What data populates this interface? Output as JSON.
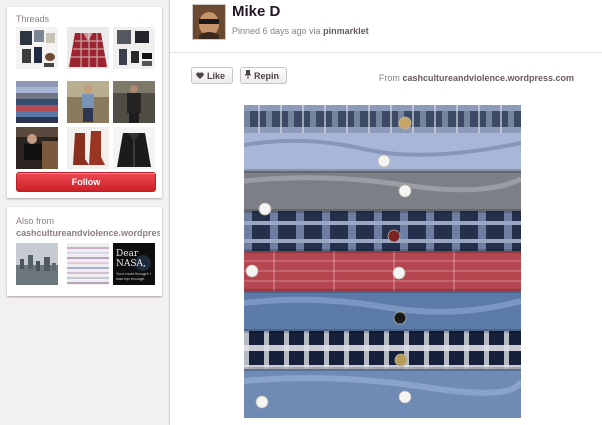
{
  "board": {
    "title": "Threads",
    "follow_label": "Follow",
    "thumbnails": [
      "outfit-flatlay",
      "red-plaid-shirt",
      "outfit-flatlay-grey",
      "folded-shirts-stack",
      "man-street-style",
      "man-in-coat",
      "woman-in-leather",
      "brown-boots",
      "black-jacket"
    ]
  },
  "also_from": {
    "title": "Also from",
    "source": "cashcultureandviolence.wordpress.com",
    "thumbnails": [
      {
        "kind": "city-skyline"
      },
      {
        "kind": "striped-shirts"
      },
      {
        "kind": "nasa-poster",
        "headline": "Dear NASA,",
        "caption": "Your mom thought I was top enough."
      }
    ]
  },
  "pin": {
    "pinner_name": "Mike D",
    "pinned_prefix": "Pinned 6 days ago via",
    "via_user": "pinmarklet",
    "like_label": "Like",
    "repin_label": "Repin",
    "source_prefix": "From",
    "source_domain": "cashcultureandviolence.wordpress.com",
    "image_kind": "stacked-button-down-shirts"
  },
  "colors": {
    "accent_red": "#cb2027",
    "page_bg": "#f2f0f0",
    "muted_text": "#8c7e7e"
  }
}
